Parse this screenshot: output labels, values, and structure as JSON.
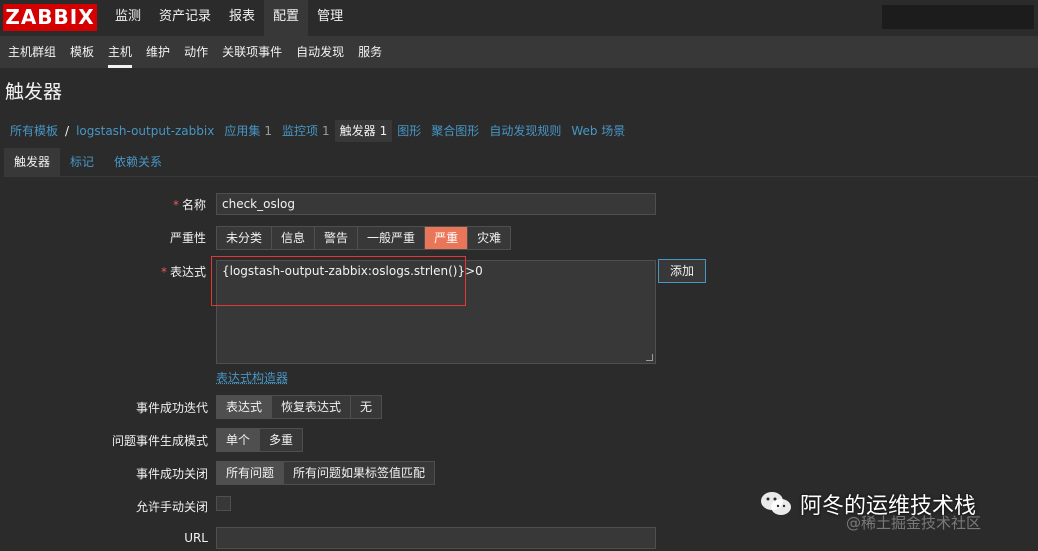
{
  "app": {
    "logo": "ZABBIX"
  },
  "top_menu": [
    {
      "label": "监测"
    },
    {
      "label": "资产记录"
    },
    {
      "label": "报表"
    },
    {
      "label": "配置"
    },
    {
      "label": "管理"
    }
  ],
  "sub_menu": [
    {
      "label": "主机群组"
    },
    {
      "label": "模板"
    },
    {
      "label": "主机"
    },
    {
      "label": "维护"
    },
    {
      "label": "动作"
    },
    {
      "label": "关联项事件"
    },
    {
      "label": "自动发现"
    },
    {
      "label": "服务"
    }
  ],
  "page": {
    "title": "触发器"
  },
  "breadcrumbs": {
    "all_templates": "所有模板",
    "separator": "/",
    "host": "logstash-output-zabbix",
    "applications": {
      "label": "应用集",
      "count": "1"
    },
    "items": {
      "label": "监控项",
      "count": "1"
    },
    "triggers": {
      "label": "触发器",
      "count": "1"
    },
    "graphs": "图形",
    "screens": "聚合图形",
    "discovery": "自动发现规则",
    "web": "Web 场景"
  },
  "tabs": [
    {
      "label": "触发器"
    },
    {
      "label": "标记"
    },
    {
      "label": "依赖关系"
    }
  ],
  "form": {
    "name": {
      "label": "名称",
      "required_mark": "*",
      "value": "check_oslog"
    },
    "severity": {
      "label": "严重性",
      "options": [
        "未分类",
        "信息",
        "警告",
        "一般严重",
        "严重",
        "灾难"
      ],
      "selected": "严重"
    },
    "expression": {
      "label": "表达式",
      "required_mark": "*",
      "value": "{logstash-output-zabbix:oslogs.strlen()}>0",
      "add_button": "添加",
      "constructor_link": "表达式构造器"
    },
    "ok_event_generation": {
      "label": "事件成功迭代",
      "options": [
        "表达式",
        "恢复表达式",
        "无"
      ],
      "selected": "表达式"
    },
    "problem_event_mode": {
      "label": "问题事件生成模式",
      "options": [
        "单个",
        "多重"
      ],
      "selected": "单个"
    },
    "ok_event_closes": {
      "label": "事件成功关闭",
      "options": [
        "所有问题",
        "所有问题如果标签值匹配"
      ],
      "selected": "所有问题"
    },
    "manual_close": {
      "label": "允许手动关闭",
      "checked": false
    },
    "url": {
      "label": "URL",
      "value": ""
    }
  },
  "watermark": {
    "main": "阿冬的运维技术栈",
    "secondary": "@稀土掘金技术社区"
  },
  "colors": {
    "brand_red": "#d40000",
    "link_blue": "#4796c4",
    "severity_selected": "#e97659",
    "highlight_box": "#e33734"
  }
}
